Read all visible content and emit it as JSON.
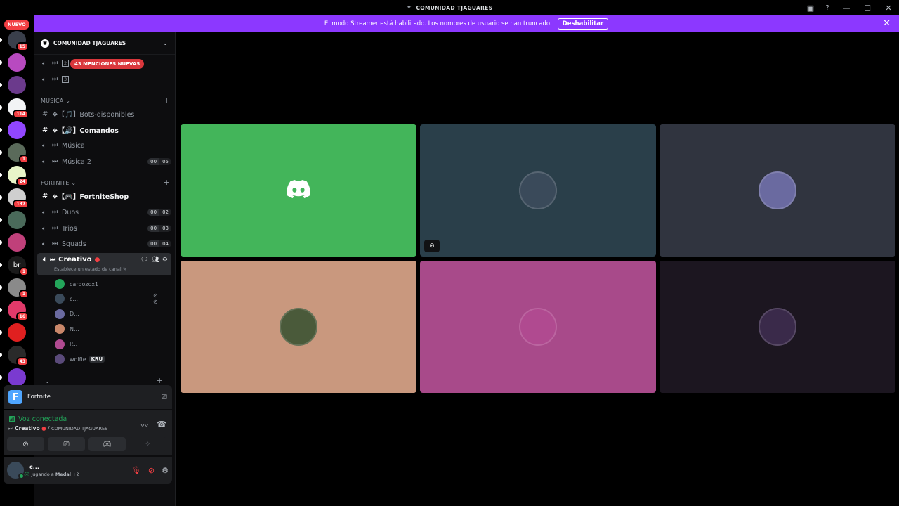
{
  "window": {
    "title": "COMUNIDAD TJAGUARES",
    "controls": [
      "—",
      "☐",
      "✕"
    ]
  },
  "banner": {
    "text": "El modo Streamer está habilitado. Los nombres de usuario se han truncado.",
    "button": "Deshabilitar",
    "color": "#8c38ff"
  },
  "servers": {
    "new_label": "NUEVO",
    "items": [
      {
        "badge": "15",
        "color": "#3a3f4b"
      },
      {
        "badge": "",
        "color": "#b84ac0"
      },
      {
        "badge": "",
        "color": "#6b3a8c"
      },
      {
        "badge": "114",
        "color": "#f2f3f5"
      },
      {
        "badge": "",
        "color": "#9146ff"
      },
      {
        "badge": "1",
        "color": "#5a6a5a"
      },
      {
        "badge": "24",
        "color": "#e8f5c8"
      },
      {
        "badge": "137",
        "color": "#cfcfcf"
      },
      {
        "badge": "",
        "color": "#4a6a5a"
      },
      {
        "badge": "",
        "color": "#c0407a"
      },
      {
        "badge": "1",
        "color": "#1a1a1a",
        "label": "br"
      },
      {
        "badge": "1",
        "color": "#8a8a8a"
      },
      {
        "badge": "16",
        "color": "#e03a6a"
      },
      {
        "badge": "",
        "color": "#e02020"
      },
      {
        "badge": "43",
        "color": "#2a2a2a"
      },
      {
        "badge": "",
        "color": "#7a3ad0"
      }
    ]
  },
  "sidebar": {
    "server_name": "COMUNIDAD TJAGUARES",
    "mention_pill": "43 MENCIONES NUEVAS",
    "channels_top": [
      {
        "label": "2"
      },
      {
        "label": "3"
      }
    ],
    "musica": {
      "category": "MUSICA",
      "channels": [
        {
          "name": "❖【🎵】Bots-disponibles",
          "type": "text"
        },
        {
          "name": "❖【🔊】Comandos",
          "type": "text",
          "bold": true
        },
        {
          "name": "Música",
          "type": "voice"
        },
        {
          "name": "Música 2",
          "type": "voice",
          "count": [
            "00",
            "05"
          ]
        }
      ]
    },
    "fortnite": {
      "category": "FORTNITE",
      "channels": [
        {
          "name": "❖【🎮】FortniteShop",
          "type": "text",
          "bold": true
        },
        {
          "name": "Duos",
          "type": "voice",
          "count": [
            "00",
            "02"
          ]
        },
        {
          "name": "Trios",
          "type": "voice",
          "count": [
            "00",
            "03"
          ]
        },
        {
          "name": "Squads",
          "type": "voice",
          "count": [
            "00",
            "04"
          ]
        }
      ]
    },
    "active": {
      "name": "Creativo",
      "status_prompt": "Establece un estado de canal"
    },
    "voice_users": [
      {
        "name": "cardozox1",
        "color": "#23a55a"
      },
      {
        "name": "c...",
        "color": "#3a4a5a",
        "muted": true
      },
      {
        "name": "D...",
        "color": "#6a6aa0"
      },
      {
        "name": "N...",
        "color": "#c9876a"
      },
      {
        "name": "P...",
        "color": "#b04a90"
      },
      {
        "name": "wolfie",
        "color": "#5a4a7a",
        "tag": "KRÜ"
      }
    ]
  },
  "activity": {
    "game": "Fortnite",
    "icon_letter": "F"
  },
  "voice_panel": {
    "status": "Voz conectada",
    "channel": "Creativo",
    "server": "COMUNIDAD TJAGUARES",
    "status_color": "#23a55a"
  },
  "user_panel": {
    "name": "c...",
    "activity_prefix": "Jugando a",
    "activity_game": "Medal",
    "activity_more": "+2"
  },
  "stage": {
    "tiles": [
      {
        "color": "#43b55a",
        "avatar": "discord",
        "avatar_color": "#43b55a"
      },
      {
        "color": "#2a3f4a",
        "avatar": "user",
        "avatar_color": "#3a4a5a",
        "muted": true
      },
      {
        "color": "#30343f",
        "avatar": "user",
        "avatar_color": "#6a6aa0"
      },
      {
        "color": "#c9987e",
        "avatar": "user",
        "avatar_color": "#4a5a3a"
      },
      {
        "color": "#a84a8a",
        "avatar": "user",
        "avatar_color": "#b04a90"
      },
      {
        "color": "#1c1620",
        "avatar": "user",
        "avatar_color": "#3a2a4a"
      }
    ]
  }
}
